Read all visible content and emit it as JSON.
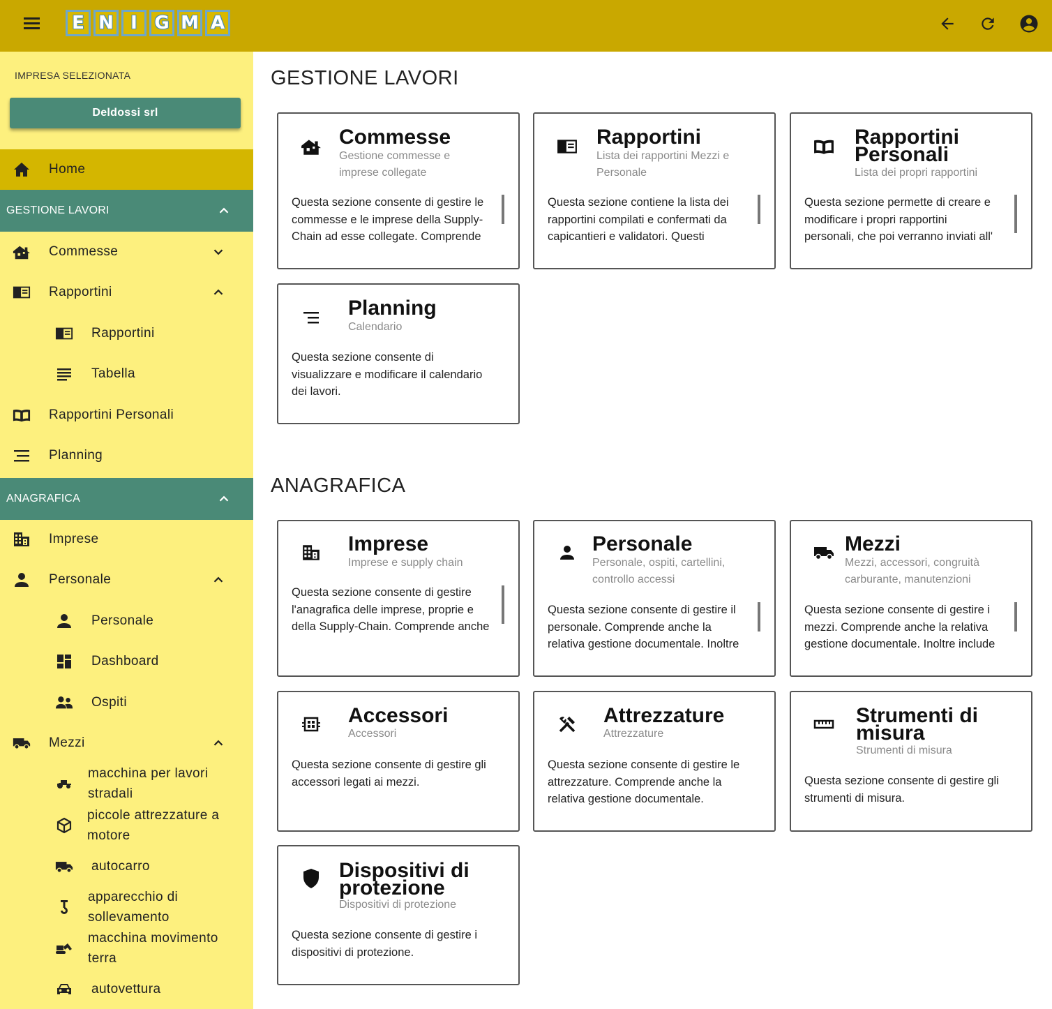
{
  "app": {
    "logo_letters": [
      "E",
      "N",
      "I",
      "G",
      "M",
      "A"
    ],
    "icons": {
      "menu": "menu-icon",
      "back": "arrow-back-icon",
      "refresh": "refresh-icon",
      "account": "account-circle-icon"
    },
    "colors": {
      "topbar": "#c9a800",
      "sidebar": "#fdf07e",
      "section_header": "#4a8a77",
      "home_active": "#d4b600"
    }
  },
  "sidebar": {
    "selected_label": "IMPRESA SELEZIONATA",
    "selected_company": "Deldossi srl",
    "home": "Home",
    "section_lavori": "GESTIONE LAVORI",
    "commesse": "Commesse",
    "rapportini": "Rapportini",
    "rapportini_sub": "Rapportini",
    "tabella": "Tabella",
    "rapportini_personali": "Rapportini Personali",
    "planning": "Planning",
    "section_anagrafica": "ANAGRAFICA",
    "imprese": "Imprese",
    "personale": "Personale",
    "personale_sub": "Personale",
    "dashboard": "Dashboard",
    "ospiti": "Ospiti",
    "mezzi": "Mezzi",
    "macchina_lavori_1": "macchina per lavori",
    "macchina_lavori_2": "stradali",
    "piccole_1": "piccole attrezzature a",
    "piccole_2": "motore",
    "autocarro": "autocarro",
    "apparecchio_1": "apparecchio di",
    "apparecchio_2": "sollevamento",
    "movimento_1": "macchina movimento",
    "movimento_2": "terra",
    "autovettura": "autovettura"
  },
  "main": {
    "gestione_title": "GESTIONE LAVORI",
    "anagrafica_title": "ANAGRAFICA",
    "cards": {
      "commesse": {
        "title": "Commesse",
        "sub1": "Gestione commesse e",
        "sub2": "imprese collegate",
        "desc": [
          "Questa sezione consente di gestire le",
          "commesse e le imprese della Supply-",
          "Chain ad esse collegate. Comprende"
        ]
      },
      "rapportini": {
        "title": "Rapportini",
        "sub1": "Lista dei rapportini Mezzi e",
        "sub2": "Personale",
        "desc": [
          "Questa sezione contiene la lista dei",
          "rapportini compilati e confermati da",
          "capicantieri e validatori. Questi"
        ]
      },
      "rapportini_personali": {
        "title1": "Rapportini",
        "title2": "Personali",
        "sub1": "Lista dei propri rapportini",
        "desc": [
          "Questa sezione permette di creare e",
          "modificare i propri rapportini",
          "personali, che poi verranno inviati all'"
        ]
      },
      "planning": {
        "title": "Planning",
        "sub1": "Calendario",
        "desc": [
          "Questa sezione consente di",
          "visualizzare e modificare il calendario",
          "dei lavori."
        ]
      },
      "imprese": {
        "title": "Imprese",
        "sub1": "Imprese e supply chain",
        "desc": [
          "Questa sezione consente di gestire",
          "l'anagrafica delle imprese, proprie e",
          "della Supply-Chain. Comprende anche"
        ]
      },
      "personale": {
        "title": "Personale",
        "sub1": "Personale, ospiti, cartellini,",
        "sub2": "controllo accessi",
        "desc": [
          "Questa sezione consente di gestire il",
          "personale. Comprende anche la",
          "relativa gestione documentale. Inoltre"
        ]
      },
      "mezzi": {
        "title": "Mezzi",
        "sub1": "Mezzi, accessori, congruità",
        "sub2": "carburante, manutenzioni",
        "desc": [
          "Questa sezione consente di gestire i",
          "mezzi. Comprende anche la relativa",
          "gestione documentale. Inoltre include"
        ]
      },
      "accessori": {
        "title": "Accessori",
        "sub1": "Accessori",
        "desc": [
          "Questa sezione consente di gestire gli",
          "accessori legati ai mezzi."
        ]
      },
      "attrezzature": {
        "title": "Attrezzature",
        "sub1": "Attrezzature",
        "desc": [
          "Questa sezione consente di gestire le",
          "attrezzature. Comprende anche la",
          "relativa gestione documentale."
        ]
      },
      "strumenti": {
        "title1": "Strumenti di",
        "title2": "misura",
        "sub1": "Strumenti di misura",
        "desc": [
          "Questa sezione consente di gestire gli",
          "strumenti di misura."
        ]
      },
      "dispositivi": {
        "title1": "Dispositivi di",
        "title2": "protezione",
        "sub1": "Dispositivi di protezione",
        "desc": [
          "Questa sezione consente di gestire i",
          "dispositivi di protezione."
        ]
      }
    }
  }
}
